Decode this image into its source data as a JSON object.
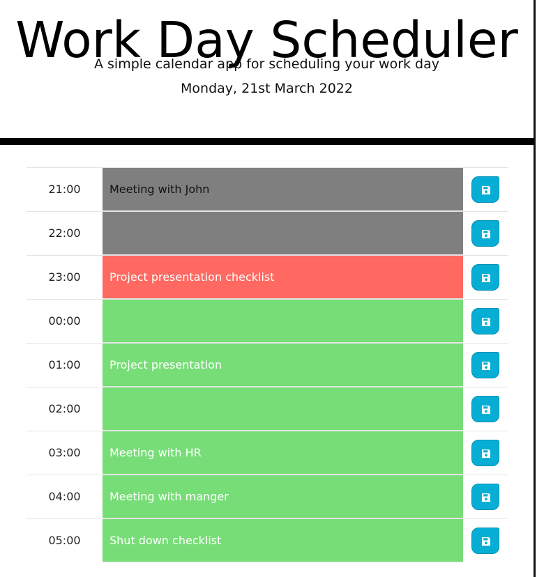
{
  "header": {
    "title": "Work Day Scheduler",
    "lead": "A simple calendar app for scheduling your work day",
    "current_date": "Monday, 21st March 2022"
  },
  "colors": {
    "past": "#7f7f7f",
    "present": "#ff6961",
    "future": "#77dd77",
    "save_button": "#06aed5"
  },
  "icons": {
    "save": "floppy-disk-icon"
  },
  "timeblocks": [
    {
      "hour": "21:00",
      "text": "Meeting with John",
      "state": "past"
    },
    {
      "hour": "22:00",
      "text": "",
      "state": "past"
    },
    {
      "hour": "23:00",
      "text": "Project presentation checklist",
      "state": "present"
    },
    {
      "hour": "00:00",
      "text": "",
      "state": "future"
    },
    {
      "hour": "01:00",
      "text": "Project presentation",
      "state": "future"
    },
    {
      "hour": "02:00",
      "text": "",
      "state": "future"
    },
    {
      "hour": "03:00",
      "text": "Meeting with HR",
      "state": "future"
    },
    {
      "hour": "04:00",
      "text": "Meeting with manger",
      "state": "future"
    },
    {
      "hour": "05:00",
      "text": "Shut down checklist",
      "state": "future"
    }
  ]
}
